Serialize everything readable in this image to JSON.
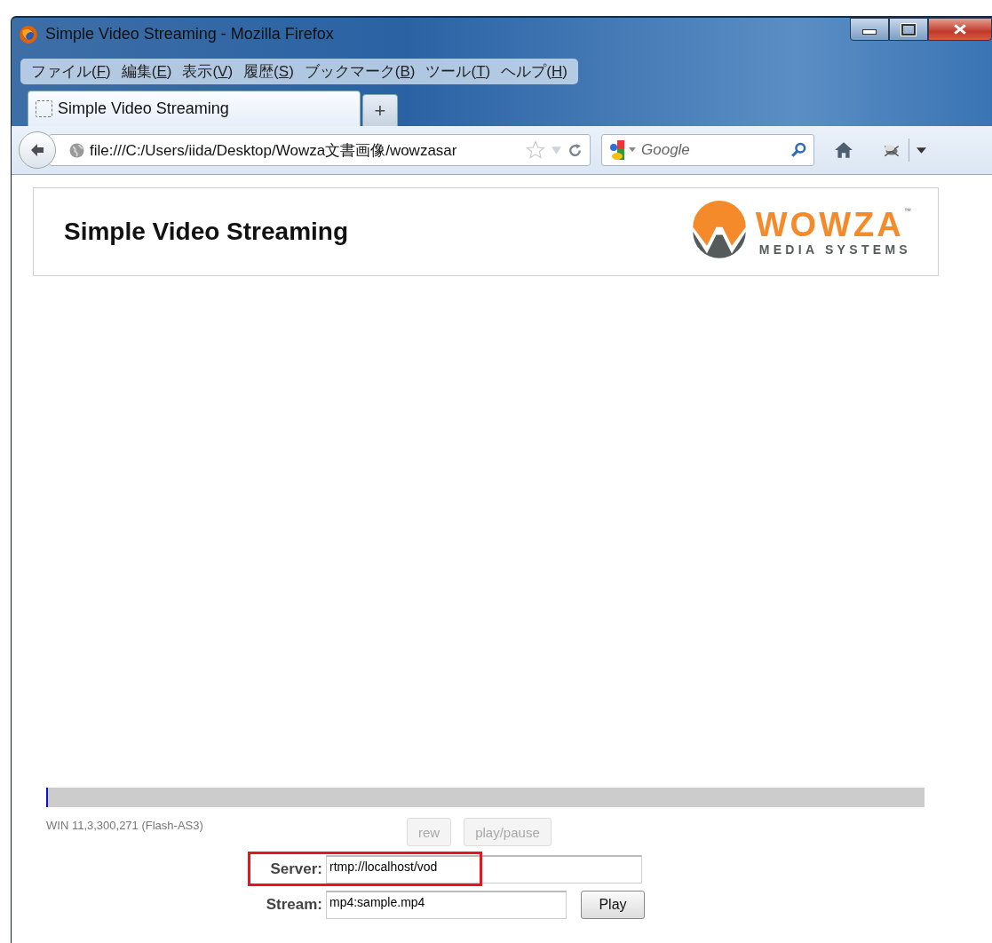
{
  "window": {
    "title": "Simple Video Streaming - Mozilla Firefox"
  },
  "menu": [
    {
      "before": "ファイル(",
      "key": "F",
      "after": ")"
    },
    {
      "before": "編集(",
      "key": "E",
      "after": ")"
    },
    {
      "before": "表示(",
      "key": "V",
      "after": ")"
    },
    {
      "before": "履歴(",
      "key": "S",
      "after": ")"
    },
    {
      "before": "ブックマーク(",
      "key": "B",
      "after": ")"
    },
    {
      "before": "ツール(",
      "key": "T",
      "after": ")"
    },
    {
      "before": "ヘルプ(",
      "key": "H",
      "after": ")"
    }
  ],
  "tabs": [
    {
      "label": "Simple Video Streaming",
      "selected": true
    }
  ],
  "new_tab": "+",
  "address_bar": {
    "value": "file:///C:/Users/iida/Desktop/Wowza文書画像/wowzasar"
  },
  "search": {
    "placeholder": "Google"
  },
  "page": {
    "title": "Simple Video Streaming",
    "logo": {
      "name": "WOWZA",
      "tm": "™",
      "tagline": "MEDIA SYSTEMS"
    },
    "progress": {
      "level": 0
    },
    "version": "WIN 11,3,300,271 (Flash-AS3)",
    "buttons": [
      {
        "label": "rew",
        "disabled": true
      },
      {
        "label": "play/pause",
        "disabled": true
      }
    ],
    "server": {
      "label": "Server:",
      "value": "rtmp://localhost/vod",
      "highlighted": true
    },
    "stream": {
      "label": "Stream:",
      "value": "mp4:sample.mp4"
    },
    "play_button": "Play"
  }
}
